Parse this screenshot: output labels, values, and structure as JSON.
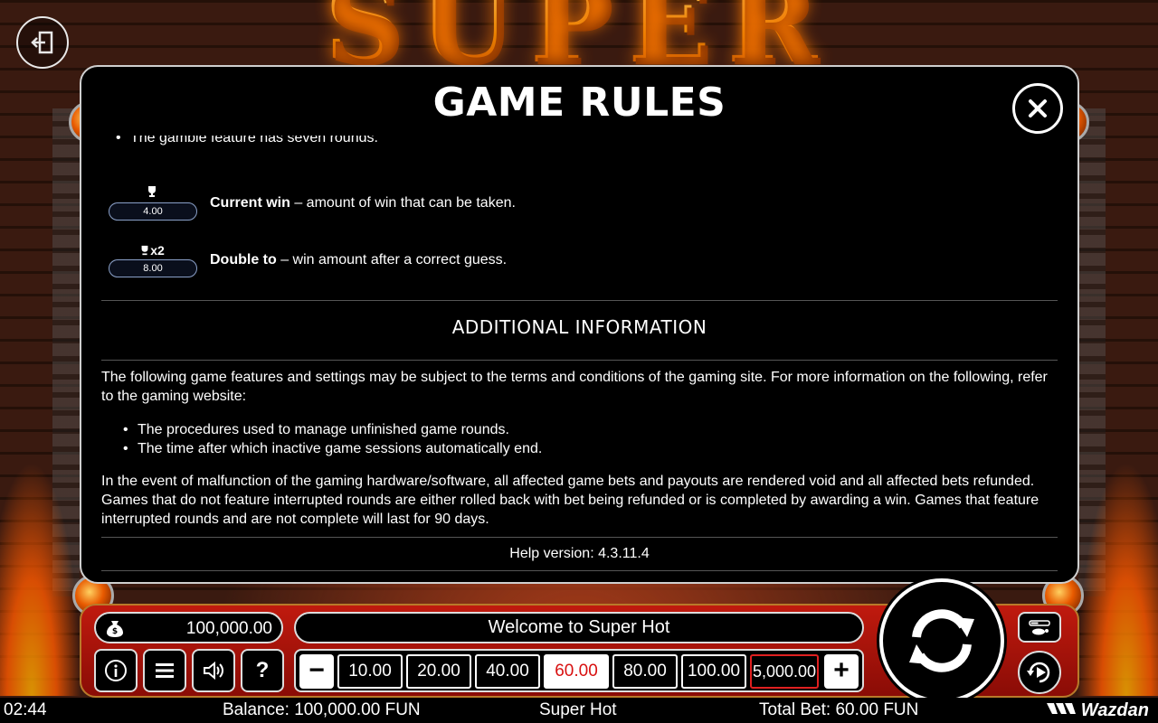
{
  "background": {
    "logo_text": "SUPER HOT"
  },
  "modal": {
    "title": "GAME RULES",
    "cut_bullet": "The gamble feature has seven rounds.",
    "current_win": {
      "value": "4.00",
      "term": "Current win",
      "description": " – amount of win that can be taken."
    },
    "double_to": {
      "icon_label": "x2",
      "value": "8.00",
      "term": "Double to",
      "description": " – win amount after a correct guess."
    },
    "additional_title": "ADDITIONAL INFORMATION",
    "additional_intro": "The following game features and settings may be subject to the terms and conditions of the gaming site. For more information on the following, refer to the gaming website:",
    "additional_bullets": [
      "The procedures used to manage unfinished game rounds.",
      "The time after which inactive game sessions automatically end."
    ],
    "malfunction_text": "In the event of malfunction of the gaming hardware/software, all affected game bets and payouts are rendered void and all affected bets refunded. Games that do not feature interrupted rounds are either rolled back with bet being refunded or is completed by awarding a win. Games that feature interrupted rounds and are not complete will last for 90 days.",
    "help_version": "Help version: 4.3.11.4"
  },
  "panel": {
    "balance": "100,000.00",
    "welcome": "Welcome to Super Hot",
    "bets": [
      "10.00",
      "20.00",
      "40.00",
      "60.00",
      "80.00",
      "100.00",
      "5,000.00"
    ],
    "selected_bet": "60.00",
    "minus_label": "−",
    "plus_label": "+",
    "help_label": "?"
  },
  "status_bar": {
    "time": "02:44",
    "balance": "Balance: 100,000.00 FUN",
    "game_title": "Super Hot",
    "total_bet": "Total Bet: 60.00 FUN",
    "brand": "Wazdan"
  },
  "colors": {
    "panel_red": "#c01a0e",
    "selected_bet_text": "#d81010",
    "max_bet_border": "#e02020"
  }
}
